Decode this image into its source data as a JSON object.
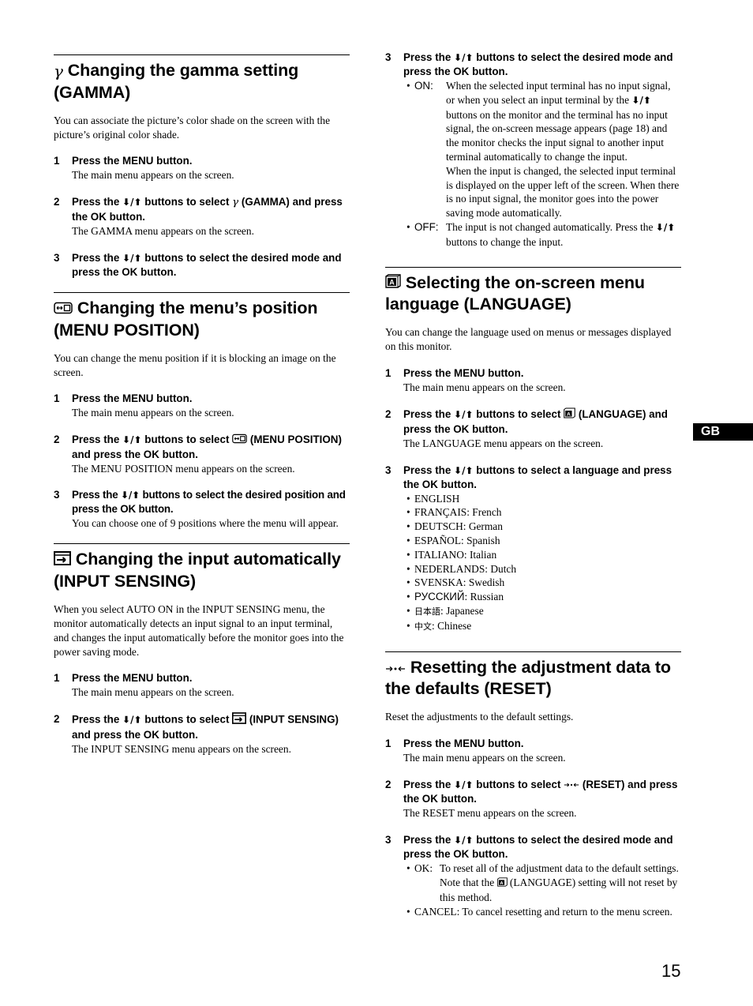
{
  "page": {
    "number": "15",
    "region_tab": "GB"
  },
  "glyphs": {
    "down_up_arrows": "⬇/⬆"
  },
  "gamma": {
    "icon": "gamma-icon",
    "title": "Changing the gamma setting (GAMMA)",
    "intro": "You can associate the picture’s color shade on the screen with the picture’s original color shade.",
    "steps": [
      {
        "num": "1",
        "title": "Press the MENU button.",
        "desc": "The main menu appears on the screen."
      },
      {
        "num": "2",
        "title_pre": "Press the",
        "title_mid": "buttons to select",
        "title_post": "(GAMMA) and press the OK button.",
        "desc": "The GAMMA menu appears on the screen."
      },
      {
        "num": "3",
        "title_pre": "Press the",
        "title_post": "buttons to select the desired mode and press the OK button."
      }
    ]
  },
  "menu_position": {
    "icon": "menu-position-icon",
    "title": "Changing the menu’s position (MENU POSITION)",
    "intro": "You can change the menu position if it is blocking an image on the screen.",
    "steps": [
      {
        "num": "1",
        "title": "Press the MENU button.",
        "desc": "The main menu appears on the screen."
      },
      {
        "num": "2",
        "title_pre": "Press the",
        "title_mid": "buttons to select",
        "title_post": "(MENU POSITION) and press the OK button.",
        "desc": "The MENU POSITION menu appears on the screen."
      },
      {
        "num": "3",
        "title_pre": "Press the",
        "title_post": "buttons to select the desired position and press the OK button.",
        "desc": "You can choose one of 9 positions where the menu will appear."
      }
    ]
  },
  "input_sensing": {
    "icon": "input-sensing-icon",
    "title": "Changing the input automatically (INPUT SENSING)",
    "intro": "When you select AUTO ON in the INPUT SENSING menu, the monitor automatically detects an input signal to an input terminal, and changes the input automatically before the monitor goes into the power saving mode.",
    "steps": [
      {
        "num": "1",
        "title": "Press the MENU button.",
        "desc": "The main menu appears on the screen."
      },
      {
        "num": "2",
        "title_pre": "Press the",
        "title_mid": "buttons to select",
        "title_post": "(INPUT SENSING) and press the OK button.",
        "desc": "The INPUT SENSING menu appears on the screen."
      },
      {
        "num": "3",
        "title_pre": "Press the",
        "title_post": "buttons to select the desired mode and press the OK button.",
        "options": [
          {
            "key": "ON:",
            "text_a": "When the selected input terminal has no input signal, or when you select an input terminal by the",
            "text_b": "buttons on the monitor and the terminal has no input signal, the on-screen message appears (page 18) and the monitor checks the input signal to another input terminal automatically to change the input.",
            "text_c": "When the input is changed, the selected input terminal is displayed on the upper left of the screen. When there is no input signal, the monitor goes into the power saving mode automatically."
          },
          {
            "key": "OFF:",
            "text_a": "The input is not changed automatically. Press the",
            "text_b": "buttons to change the input."
          }
        ]
      }
    ]
  },
  "language": {
    "icon": "language-icon",
    "title": "Selecting the on-screen menu language (LANGUAGE)",
    "intro": "You can change the language used on menus or messages displayed on this monitor.",
    "steps": [
      {
        "num": "1",
        "title": "Press the MENU button.",
        "desc": "The main menu appears on the screen."
      },
      {
        "num": "2",
        "title_pre": "Press the",
        "title_mid": "buttons to select",
        "title_post": "(LANGUAGE) and press the OK button.",
        "desc": "The LANGUAGE menu appears on the screen."
      },
      {
        "num": "3",
        "title_pre": "Press the",
        "title_post": "buttons to select a language and press the OK button.",
        "languages": [
          {
            "native": "ENGLISH",
            "english": ""
          },
          {
            "native": "FRANÇAIS",
            "english": ": French"
          },
          {
            "native": "DEUTSCH",
            "english": ": German"
          },
          {
            "native": "ESPAÑOL",
            "english": ": Spanish"
          },
          {
            "native": "ITALIANO",
            "english": ": Italian"
          },
          {
            "native": "NEDERLANDS",
            "english": ": Dutch"
          },
          {
            "native": "SVENSKA",
            "english": ": Swedish"
          },
          {
            "native": "РУССКИЙ",
            "english": ": Russian"
          },
          {
            "native": "日本語",
            "english": ": Japanese"
          },
          {
            "native": "中文",
            "english": ": Chinese"
          }
        ]
      }
    ]
  },
  "reset": {
    "icon": "reset-icon",
    "title": "Resetting the adjustment data to the defaults (RESET)",
    "intro": "Reset the adjustments to the default settings.",
    "steps": [
      {
        "num": "1",
        "title": "Press the MENU button.",
        "desc": "The main menu appears on the screen."
      },
      {
        "num": "2",
        "title_pre": "Press the",
        "title_mid": "buttons to select",
        "title_post": "(RESET) and press the OK button.",
        "desc": "The RESET menu appears on the screen."
      },
      {
        "num": "3",
        "title_pre": "Press the",
        "title_post": "buttons to select the desired mode and press the OK button.",
        "options": [
          {
            "key": "OK:",
            "text_a": "To reset all of the adjustment data to the default settings. Note that the",
            "text_b": "(LANGUAGE) setting will not reset by this method."
          },
          {
            "key": "CANCEL:",
            "text_a": "To cancel resetting and return to the menu screen."
          }
        ]
      }
    ]
  }
}
